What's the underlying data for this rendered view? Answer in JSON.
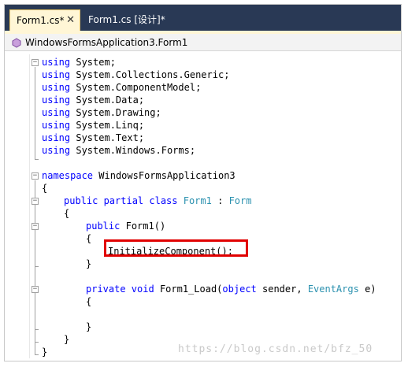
{
  "tabs": [
    {
      "label": "Form1.cs*",
      "active": true
    },
    {
      "label": "Form1.cs [设计]*",
      "active": false
    }
  ],
  "tab_close_glyph": "✕",
  "nav_bar": {
    "class_path": "WindowsFormsApplication3.Form1",
    "icon": "class-icon"
  },
  "code": {
    "usings": [
      "System",
      "System.Collections.Generic",
      "System.ComponentModel",
      "System.Data",
      "System.Drawing",
      "System.Linq",
      "System.Text",
      "System.Windows.Forms"
    ],
    "using_keyword": "using",
    "namespace_keyword": "namespace",
    "namespace_name": "WindowsFormsApplication3",
    "class_modifiers": "public partial class",
    "class_name": "Form1",
    "base_separator": ":",
    "base_class": "Form",
    "ctor_keyword": "public",
    "ctor_signature": "Form1()",
    "init_call": "InitializeComponent();",
    "load_modifiers": "private void",
    "load_name": "Form1_Load(",
    "param1_type": "object",
    "param1_name": " sender, ",
    "param2_type": "EventArgs",
    "param2_name": " e)",
    "open_brace": "{",
    "close_brace": "}"
  },
  "watermark": "https://blog.csdn.net/bfz_50",
  "colors": {
    "keyword": "#0000ff",
    "type": "#2b91af",
    "tab_active_bg": "#fff6d6",
    "tab_strip_bg": "#293955",
    "highlight_border": "#e10000"
  }
}
